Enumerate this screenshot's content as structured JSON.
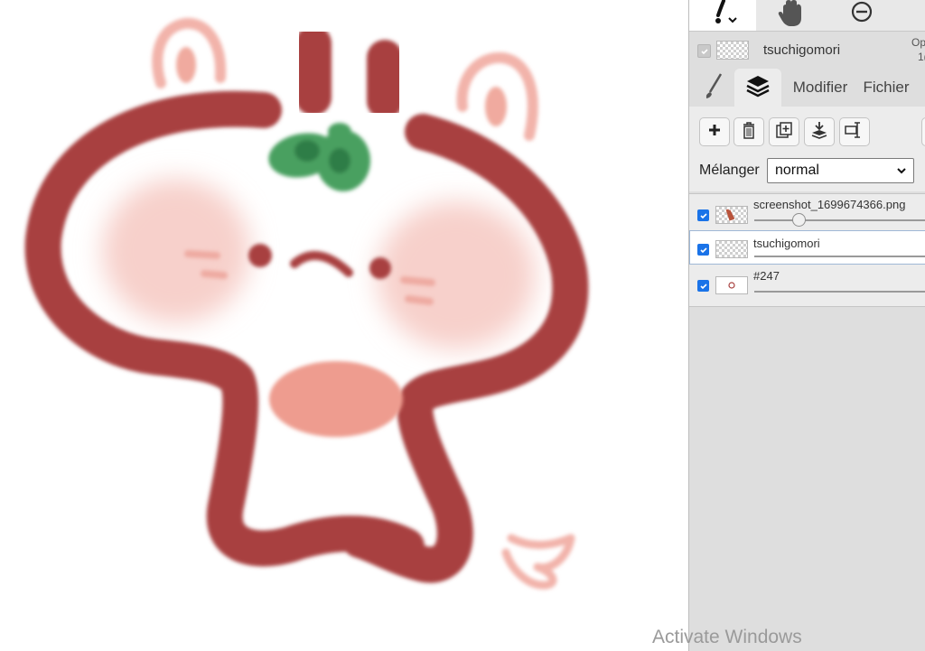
{
  "canvas": {
    "description_icon": "bear-drawing"
  },
  "toolbar": {
    "tools": [
      {
        "icon": "brush-cursor-icon",
        "active": true
      },
      {
        "icon": "hand-icon",
        "active": false
      },
      {
        "icon": "zoom-out-icon",
        "active": false
      }
    ]
  },
  "current_layer": {
    "name": "tsuchigomori",
    "opacity_label": "Op",
    "opacity_value_partial": "1("
  },
  "tabs": {
    "brush_icon": "brush-icon",
    "layers_icon": "layers-icon",
    "modify_label": "Modifier",
    "file_label": "Fichier"
  },
  "layer_actions": [
    {
      "name": "add-layer-button",
      "icon": "plus-icon"
    },
    {
      "name": "delete-layer-button",
      "icon": "trash-icon"
    },
    {
      "name": "duplicate-layer-button",
      "icon": "duplicate-icon"
    },
    {
      "name": "merge-down-button",
      "icon": "merge-down-icon"
    },
    {
      "name": "rename-layer-button",
      "icon": "rename-icon"
    }
  ],
  "blend": {
    "label": "Mélanger",
    "value": "normal"
  },
  "layers": [
    {
      "name": "screenshot_1699674366.png",
      "checked": true,
      "selected": false,
      "opacity": 0.26
    },
    {
      "name": "tsuchigomori",
      "checked": true,
      "selected": true,
      "opacity": 1.0
    },
    {
      "name": "#247",
      "checked": true,
      "selected": false,
      "opacity": 1.0
    }
  ],
  "watermark": {
    "text": "Activate Windows"
  },
  "colors": {
    "brown": "#a8413f",
    "pink_blush": "#f7d3cf",
    "green_leaf": "#4aa060",
    "ear_pink": "#eea89e"
  }
}
